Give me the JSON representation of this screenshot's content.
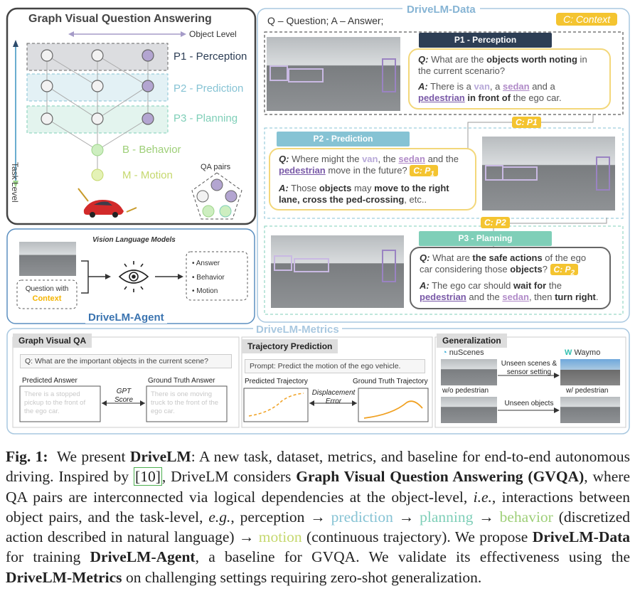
{
  "gvqa": {
    "title": "Graph Visual Question Answering",
    "object_level": "Object Level",
    "task_level": "Task Level",
    "p1": "P1 - Perception",
    "p2": "P2 - Prediction",
    "p3": "P3 - Planning",
    "behavior": "B - Behavior",
    "motion": "M - Motion",
    "qa_pairs": "QA pairs"
  },
  "agent": {
    "vlm_label": "Vision Language Models",
    "question_ctx_1": "Question with",
    "question_ctx_2": "Context",
    "outputs": [
      "Answer",
      "Behavior",
      "Motion"
    ],
    "title": "DriveLM-Agent"
  },
  "data": {
    "title": "DriveLM-Data",
    "legend": "Q – Question; A – Answer;",
    "context_tag": "C: Context",
    "p1_header": "P1 - Perception",
    "p1_q": "What are the objects worth noting in the current scenario?",
    "p1_a": "There is a van, a sedan and a pedestrian in front of the ego car.",
    "p2_header": "P2 - Prediction",
    "p2_q": "Where might the van, the sedan and the pedestrian move in the future?",
    "p2_a": "Those objects may move to the right lane, cross the ped-crossing, etc..",
    "p3_header": "P3 - Planning",
    "p3_q": "What are the safe actions of the ego car considering those objects?",
    "p3_a": "The ego car should wait for the pedestrian and the sedan, then turn right.",
    "c_p1": "C: P1",
    "c_p2": "C: P2"
  },
  "metrics": {
    "title": "DriveLM-Metrics",
    "gvqa_header": "Graph Visual QA",
    "gvqa_q": "Q: What are the important objects in the current scene?",
    "pred_answer": "Predicted Answer",
    "gt_answer": "Ground Truth Answer",
    "pred_text": "There is a stopped pickup to the front of the ego car.",
    "gt_text": "There is one moving truck to the front of the ego car.",
    "gpt_score": "GPT Score",
    "traj_header": "Trajectory Prediction",
    "prompt": "Prompt: Predict the motion of the ego vehicle.",
    "pred_traj": "Predicted Trajectory",
    "gt_traj": "Ground Truth Trajectory",
    "disp_error": "Displacement Error",
    "gen_header": "Generalization",
    "nuscenes": "nuScenes",
    "waymo": "Waymo",
    "unseen_scenes": "Unseen scenes & sensor setting",
    "unseen_objects": "Unseen objects",
    "wo_ped": "w/o pedestrian",
    "w_ped": "w/ pedestrian"
  },
  "caption": {
    "fig": "Fig. 1:",
    "cite": "[10]"
  }
}
